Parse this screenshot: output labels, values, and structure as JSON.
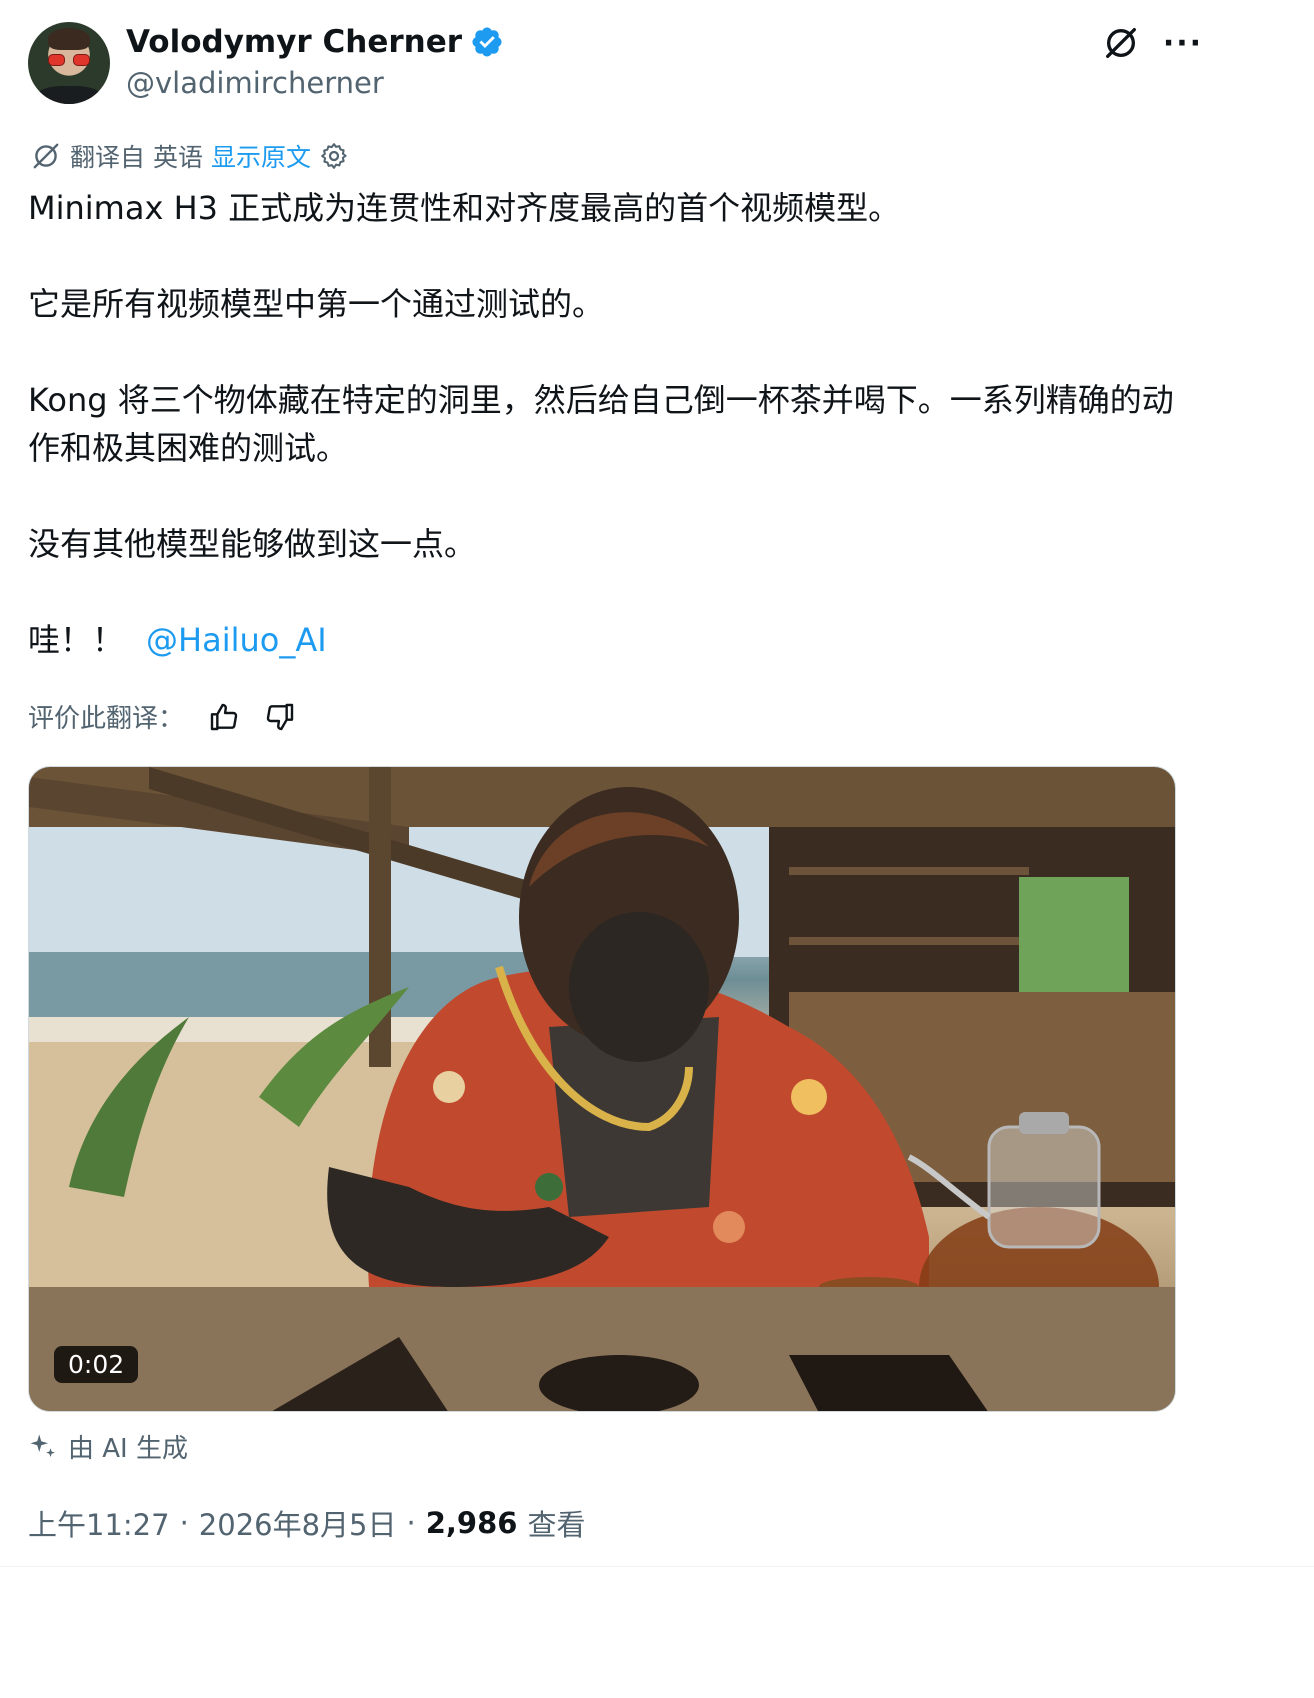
{
  "author": {
    "name": "Volodymyr Cherner",
    "handle": "@vladimircherner",
    "verified": true
  },
  "translation": {
    "label": "翻译自 英语",
    "show_original": "显示原文"
  },
  "tweet": {
    "lines": [
      "Minimax H3 正式成为连贯性和对齐度最高的首个视频模型。",
      "它是所有视频模型中第一个通过测试的。",
      "Kong 将三个物体藏在特定的洞里，然后给自己倒一杯茶并喝下。一系列精确的动作和极其困难的测试。",
      "没有其他模型能够做到这一点。",
      "哇！！"
    ],
    "mention": "@Hailuo_AI"
  },
  "rate_translation": {
    "label": "评价此翻译："
  },
  "media": {
    "timer": "0:02"
  },
  "ai_label": "由 AI 生成",
  "meta": {
    "time": "上午11:27",
    "date": "2026年8月5日",
    "views_count": "2,986",
    "views_label": "查看"
  },
  "colors": {
    "accent": "#1d9bf0",
    "muted": "#536471",
    "text": "#0f1419"
  }
}
